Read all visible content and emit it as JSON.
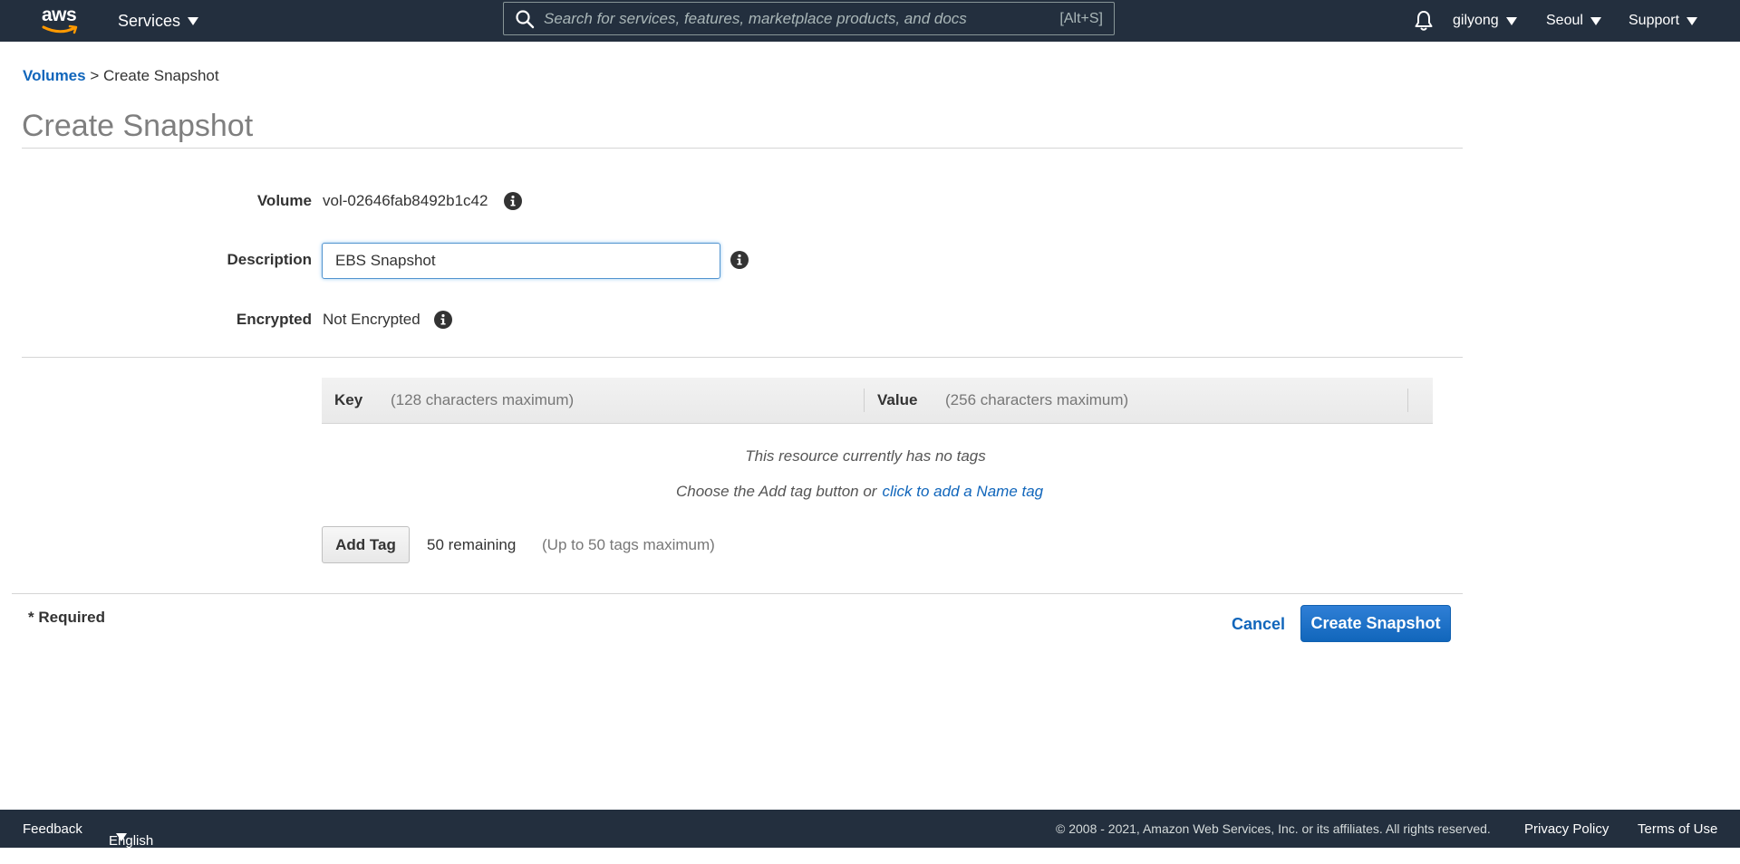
{
  "topnav": {
    "logo_text": "aws",
    "services_label": "Services",
    "search_placeholder": "Search for services, features, marketplace products, and docs",
    "search_shortcut": "[Alt+S]",
    "user_label": "gilyong",
    "region_label": "Seoul",
    "support_label": "Support"
  },
  "breadcrumb": {
    "parent": "Volumes",
    "separator": ">",
    "current": "Create Snapshot"
  },
  "page": {
    "title": "Create Snapshot"
  },
  "form": {
    "volume": {
      "label": "Volume",
      "value": "vol-02646fab8492b1c42"
    },
    "description": {
      "label": "Description",
      "value": "EBS Snapshot"
    },
    "encrypted": {
      "label": "Encrypted",
      "value": "Not Encrypted"
    }
  },
  "tags": {
    "key_header": "Key",
    "key_hint": "(128 characters maximum)",
    "value_header": "Value",
    "value_hint": "(256 characters maximum)",
    "empty_message": "This resource currently has no tags",
    "empty_hint": "Choose the Add tag button or",
    "empty_hint_link": "click to add a Name tag",
    "add_tag_label": "Add Tag",
    "remaining": "50 remaining",
    "limit": "(Up to 50 tags maximum)"
  },
  "actions": {
    "required_note": "* Required",
    "cancel_label": "Cancel",
    "create_label": "Create Snapshot"
  },
  "footer": {
    "feedback": "Feedback",
    "language": "English (US)",
    "copyright": "© 2008 - 2021, Amazon Web Services, Inc. or its affiliates. All rights reserved.",
    "privacy": "Privacy Policy",
    "terms": "Terms of Use"
  },
  "colors": {
    "nav_bg": "#232f3e",
    "link": "#1166bb",
    "primary_button": "#1166bb",
    "smile": "#ff9900"
  }
}
